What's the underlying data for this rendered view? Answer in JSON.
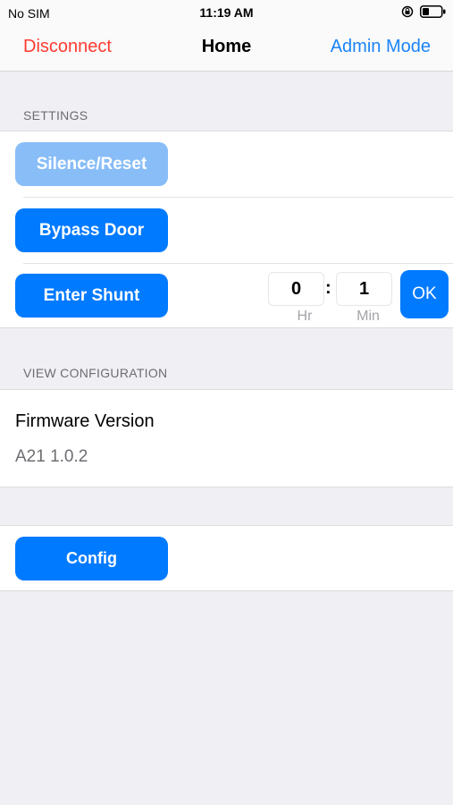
{
  "status_bar": {
    "carrier": "No SIM",
    "time": "11:19 AM",
    "icons": [
      "orientation-lock-icon",
      "battery-icon"
    ]
  },
  "nav": {
    "left": "Disconnect",
    "title": "Home",
    "right": "Admin Mode"
  },
  "settings": {
    "header": "SETTINGS",
    "silence_reset": "Silence/Reset",
    "bypass_door": "Bypass Door",
    "enter_shunt": "Enter Shunt",
    "hours": "0",
    "colon": ":",
    "minutes": "1",
    "hours_label": "Hr",
    "minutes_label": "Min",
    "ok": "OK"
  },
  "view_configuration": {
    "header": "VIEW CONFIGURATION",
    "firmware_label": "Firmware Version",
    "firmware_value": "A21 1.0.2"
  },
  "actions": {
    "config": "Config"
  },
  "colors": {
    "accent": "#007aff",
    "destructive": "#ff3b30",
    "disabled_button": "#88bdf7",
    "background": "#efeff4"
  }
}
